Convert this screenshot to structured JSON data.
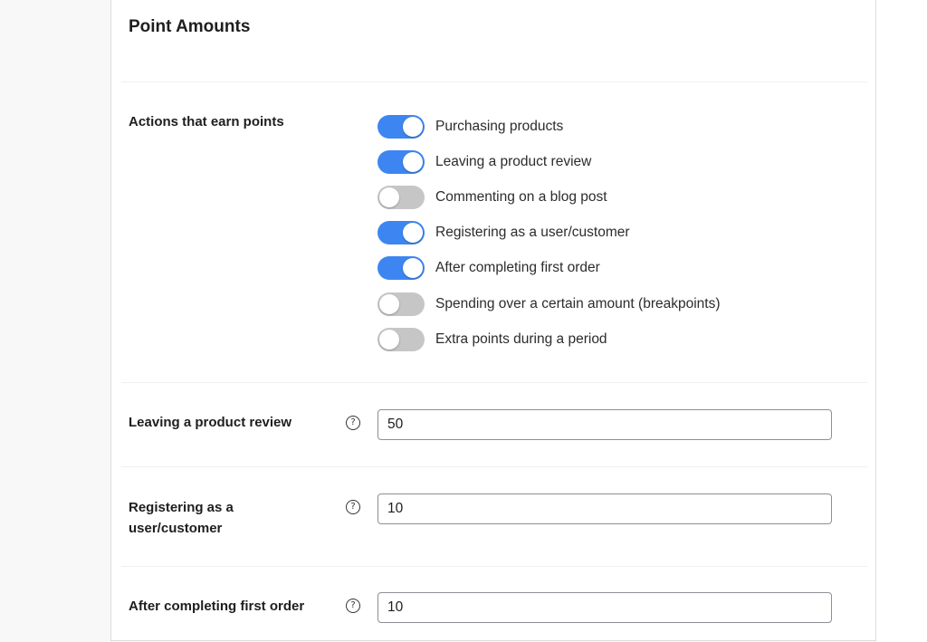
{
  "section": {
    "title": "Point Amounts"
  },
  "actions": {
    "label": "Actions that earn points",
    "items": [
      {
        "label": "Purchasing products",
        "enabled": true
      },
      {
        "label": "Leaving a product review",
        "enabled": true
      },
      {
        "label": "Commenting on a blog post",
        "enabled": false
      },
      {
        "label": "Registering as a user/customer",
        "enabled": true
      },
      {
        "label": "After completing first order",
        "enabled": true
      },
      {
        "label": "Spending over a certain amount (breakpoints)",
        "enabled": false
      },
      {
        "label": "Extra points during a period",
        "enabled": false
      }
    ]
  },
  "fields": [
    {
      "label": "Leaving a product review",
      "value": "50",
      "help_icon": "question-circle-icon"
    },
    {
      "label": "Registering as a user/customer",
      "value": "10",
      "help_icon": "question-circle-icon"
    },
    {
      "label": "After completing first order",
      "value": "10",
      "help_icon": "question-circle-icon"
    }
  ],
  "colors": {
    "toggle_on": "#3d86f2",
    "toggle_off": "#c6c6c6"
  }
}
